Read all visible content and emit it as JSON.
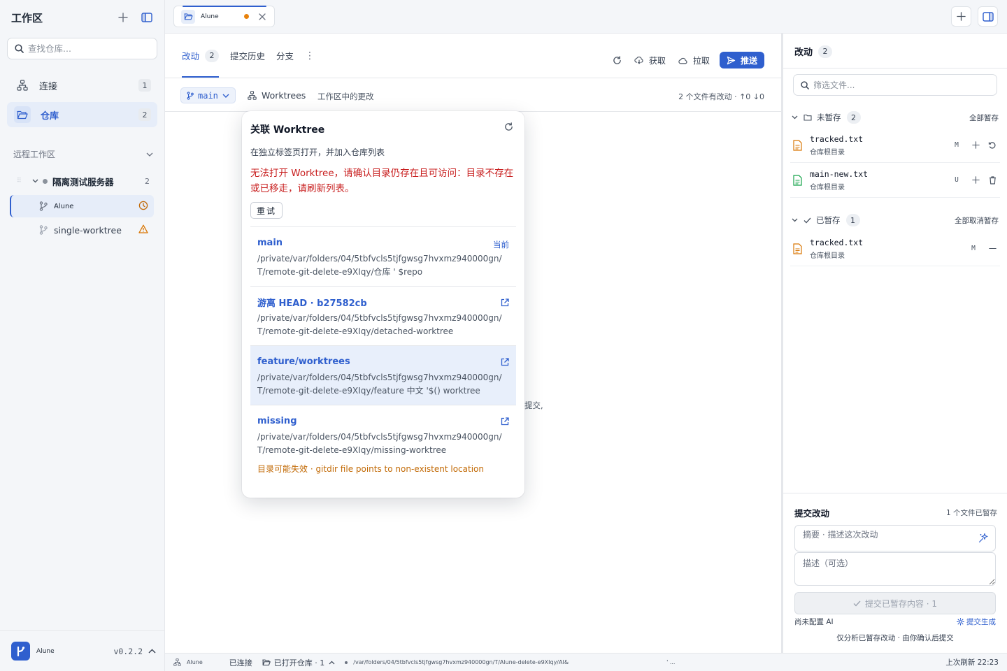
{
  "sidebar": {
    "title": "工作区",
    "search_placeholder": "查找仓库...",
    "nav": [
      {
        "label": "连接",
        "count": "1"
      },
      {
        "label": "仓库",
        "count": "2"
      }
    ],
    "section_label": "远程工作区",
    "server": {
      "name": "隔离测试服务器",
      "count": "2"
    },
    "worktrees": [
      {
        "label": "Alune",
        "status_icon": "clock-icon"
      },
      {
        "label": "single-worktree",
        "status_icon": "warning-icon"
      }
    ],
    "footer": {
      "app_name": "Alune",
      "version": "v0.2.2"
    }
  },
  "tabbar": {
    "tabs": [
      {
        "label": "Alune"
      }
    ]
  },
  "main": {
    "tabs": [
      {
        "label": "改动",
        "count": "2"
      },
      {
        "label": "提交历史"
      },
      {
        "label": "分支"
      }
    ],
    "more": "⋮",
    "actions": {
      "fetch": "获取",
      "pull": "拉取",
      "push": "推送"
    },
    "branch": "main",
    "worktrees_label": "Worktrees",
    "changes_label": "工作区中的更改",
    "summary": "2 个文件有改动 · ↑0 ↓0",
    "empty_hint": "提交,"
  },
  "popover": {
    "title": "关联 Worktree",
    "subtitle": "在独立标签页打开，并加入仓库列表",
    "error": "无法打开 Worktree，请确认目录仍存在且可访问：目录不存在或已移走，请刷新列表。",
    "retry": "重试",
    "items": [
      {
        "name": "main",
        "tag": "当前",
        "path": "/private/var/folders/04/5tbfvcls5tjfgwsg7hvxmz940000gn/T/remote-git-delete-e9XIqy/仓库 ' $repo"
      },
      {
        "name": "游离 HEAD · b27582cb",
        "path": "/private/var/folders/04/5tbfvcls5tjfgwsg7hvxmz940000gn/T/remote-git-delete-e9XIqy/detached-worktree"
      },
      {
        "name": "feature/worktrees",
        "path": "/private/var/folders/04/5tbfvcls5tjfgwsg7hvxmz940000gn/T/remote-git-delete-e9XIqy/feature 中文 '$() worktree"
      },
      {
        "name": "missing",
        "path": "/private/var/folders/04/5tbfvcls5tjfgwsg7hvxmz940000gn/T/remote-git-delete-e9XIqy/missing-worktree",
        "warning": "目录可能失效 · gitdir file points to non-existent location"
      }
    ]
  },
  "changes": {
    "title": "改动",
    "count": "2",
    "filter_placeholder": "筛选文件...",
    "unstaged": {
      "label": "未暂存",
      "count": "2",
      "action": "全部暂存",
      "files": [
        {
          "name": "tracked.txt",
          "dir": "仓库根目录",
          "status": "M"
        },
        {
          "name": "main-new.txt",
          "dir": "仓库根目录",
          "status": "U"
        }
      ]
    },
    "staged": {
      "label": "已暂存",
      "count": "1",
      "action": "全部取消暂存",
      "files": [
        {
          "name": "tracked.txt",
          "dir": "仓库根目录",
          "status": "M"
        }
      ]
    }
  },
  "commit": {
    "title": "提交改动",
    "meta": "1 个文件已暂存",
    "summary_placeholder": "摘要 · 描述这次改动",
    "description_placeholder": "描述（可选）",
    "button": "提交已暂存内容 · 1",
    "ai_status": "尚未配置 AI",
    "ai_generate": "提交生成",
    "note": "仅分析已暂存改动 · 由你确认后提交"
  },
  "statusbar": {
    "app": "Alune",
    "connected": "已连接",
    "open_repos": "已打开仓库 · 1",
    "path": "/var/folders/04/5tbfvcls5tjfgwsg7hvxmz940000gn/T/Alune-delete-e9XIqy/AI&",
    "path_tail": "' ...",
    "refreshed": "上次刷新 22:23"
  },
  "colors": {
    "accent": "#2f5fce",
    "error": "#c81e1e",
    "warning": "#c26a06",
    "modified": "#d97706",
    "untracked": "#16a34a",
    "dirty_dot": "#e8820c"
  }
}
